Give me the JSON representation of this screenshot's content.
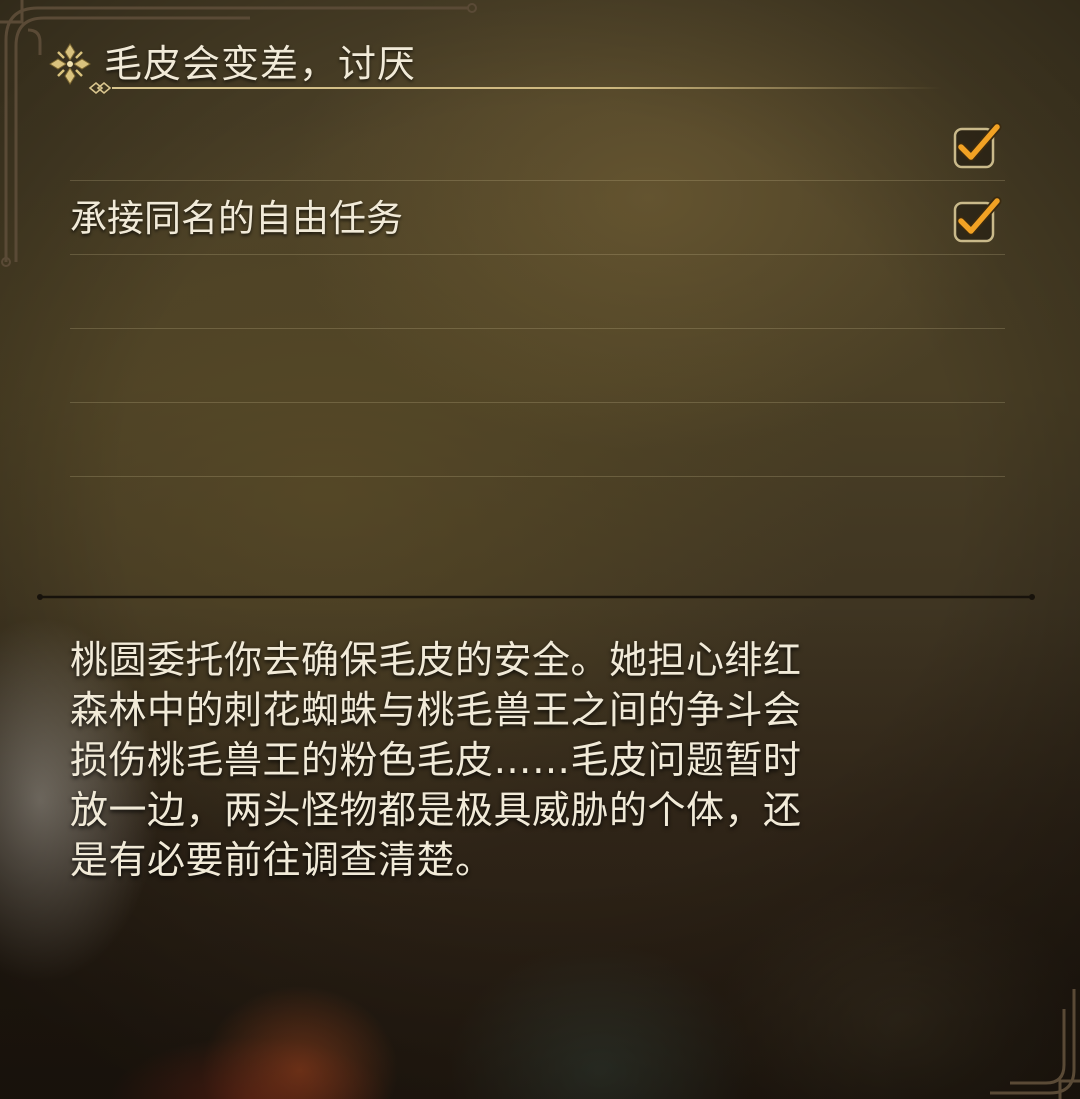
{
  "quest": {
    "title": "毛皮会变差，讨厌",
    "objectives": [
      {
        "label": "",
        "checked": true
      },
      {
        "label": "承接同名的自由任务",
        "checked": true
      },
      {
        "label": "",
        "checked": false
      },
      {
        "label": "",
        "checked": false
      },
      {
        "label": "",
        "checked": false
      }
    ],
    "description_lines": [
      "桃圆委托你去确保毛皮的安全。她担心绯红",
      "森林中的刺花蜘蛛与桃毛兽王之间的争斗会",
      "损伤桃毛兽王的粉色毛皮……毛皮问题暂时",
      "放一边，两头怪物都是极具威胁的个体，还",
      "是有必要前往调查清楚。"
    ]
  },
  "icons": {
    "title": "ornate-quest-marker-icon",
    "check": "checkmark-icon"
  },
  "colors": {
    "accent_gold": "#d8c58e",
    "check_orange": "#f0a020",
    "text": "#f1ead8"
  }
}
